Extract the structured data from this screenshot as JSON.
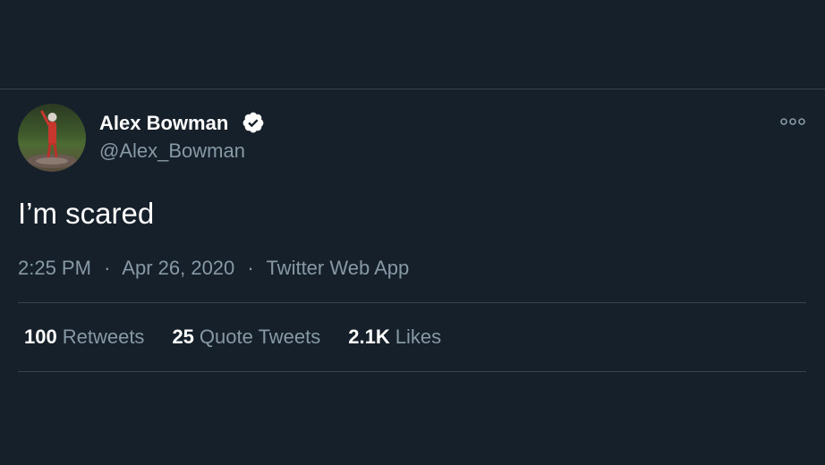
{
  "tweet": {
    "author": {
      "display_name": "Alex Bowman",
      "handle": "@Alex_Bowman",
      "verified": true,
      "avatar_icon": "profile-photo-driver"
    },
    "text": "I’m scared",
    "time": "2:25 PM",
    "date": "Apr 26, 2020",
    "source": "Twitter Web App",
    "separator": "·"
  },
  "stats": {
    "retweets": {
      "count": "100",
      "label": "Retweets"
    },
    "quotes": {
      "count": "25",
      "label": "Quote Tweets"
    },
    "likes": {
      "count": "2.1K",
      "label": "Likes"
    }
  },
  "icons": {
    "more": "more-options-icon",
    "verified": "verified-badge-icon"
  },
  "colors": {
    "background": "#15202b",
    "primary_text": "#ffffff",
    "secondary_text": "#8899a6",
    "divider": "#38444d"
  }
}
